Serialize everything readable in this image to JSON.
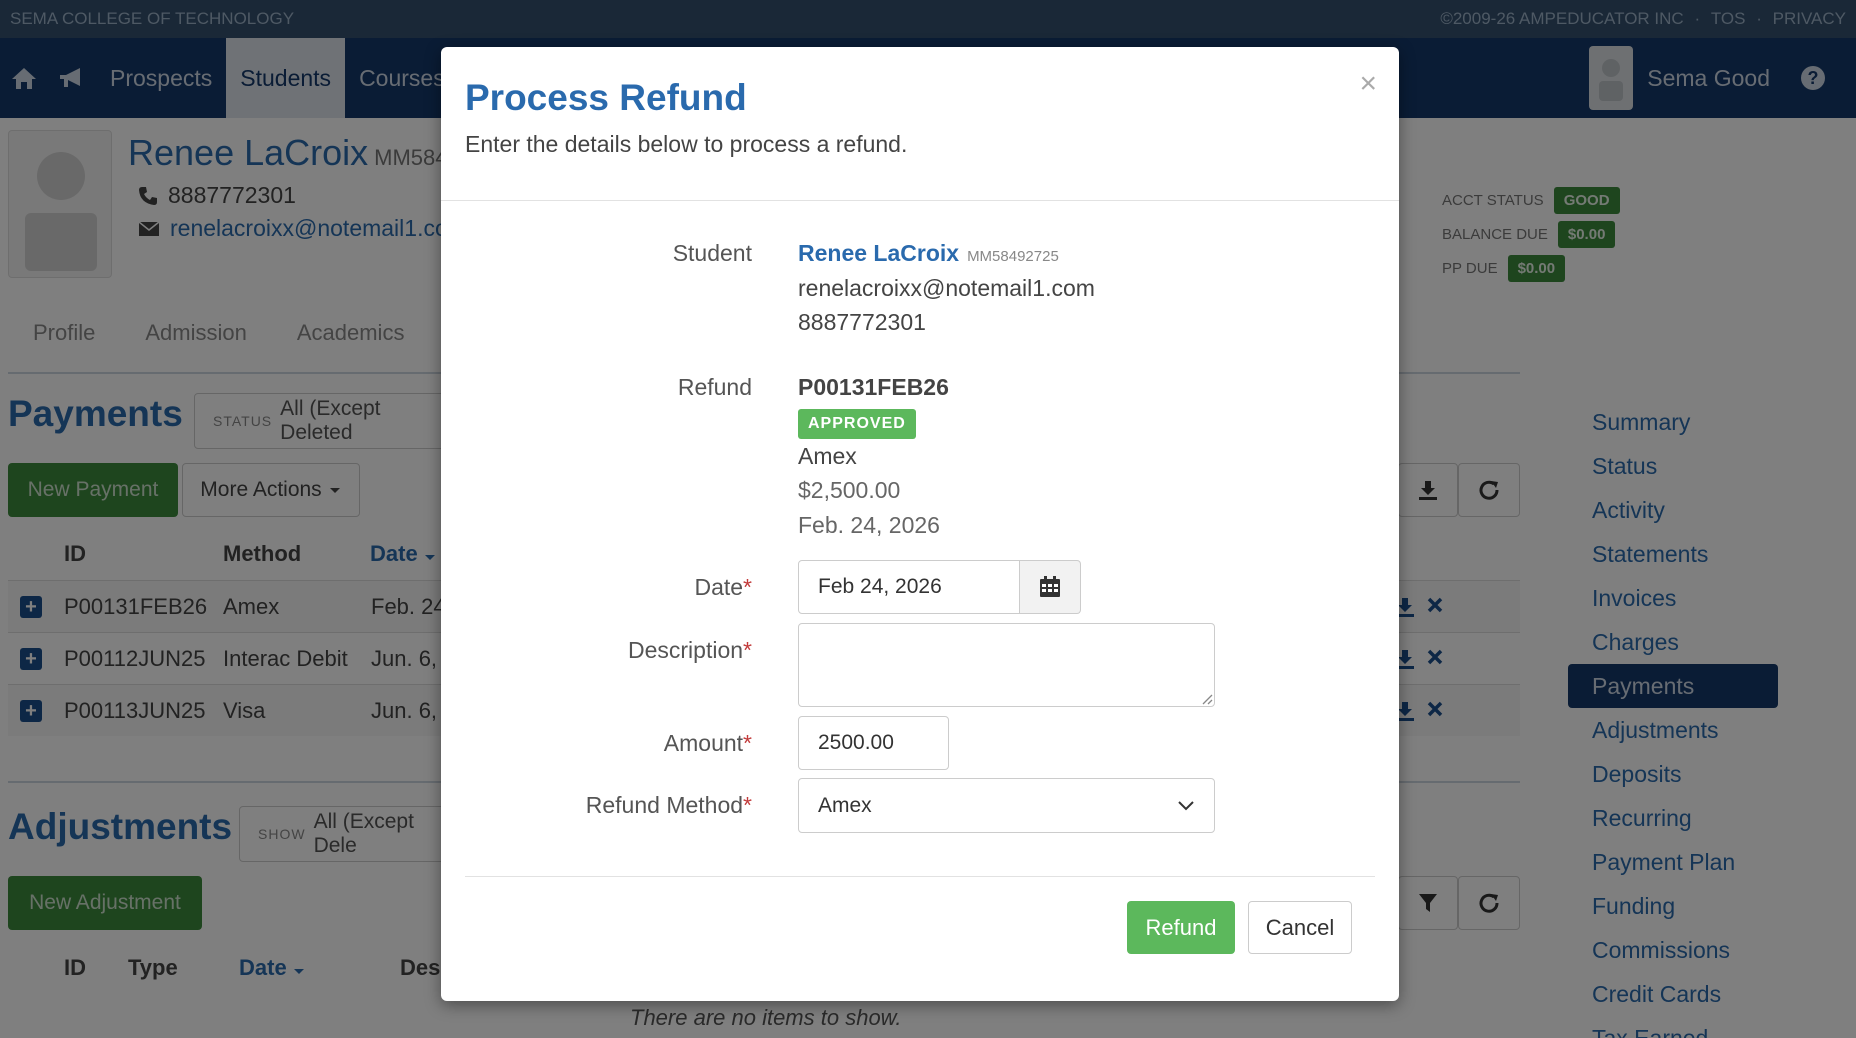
{
  "topbar": {
    "org": "SEMA COLLEGE OF TECHNOLOGY",
    "copyright": "©2009-26 AMPEDUCATOR INC",
    "tos": "TOS",
    "privacy": "PRIVACY",
    "separator": "·"
  },
  "nav": {
    "items": [
      {
        "label": "Prospects"
      },
      {
        "label": "Students"
      },
      {
        "label": "Courses"
      }
    ],
    "user_name": "Sema Good"
  },
  "student": {
    "name": "Renee LaCroix",
    "id_partial": "MM584",
    "phone": "8887772301",
    "email_partial": "renelacroixx@notemail1.co"
  },
  "tabs": [
    "Profile",
    "Admission",
    "Academics"
  ],
  "payments": {
    "title": "Payments",
    "status_label": "STATUS",
    "status_value": "All (Except Deleted",
    "new_button": "New Payment",
    "more_button": "More Actions",
    "columns": [
      "ID",
      "Method",
      "Date"
    ],
    "rows": [
      {
        "id": "P00131FEB26",
        "method": "Amex",
        "date": "Feb. 24"
      },
      {
        "id": "P00112JUN25",
        "method": "Interac Debit",
        "date": "Jun. 6,"
      },
      {
        "id": "P00113JUN25",
        "method": "Visa",
        "date": "Jun. 6,"
      }
    ]
  },
  "adjustments": {
    "title": "Adjustments",
    "show_label": "SHOW",
    "show_value": "All (Except Dele",
    "new_button": "New Adjustment",
    "columns": [
      "ID",
      "Type",
      "Date",
      "Des"
    ],
    "empty_text": "There are no items to show."
  },
  "account": {
    "acct_status_label": "ACCT STATUS",
    "acct_status_value": "GOOD",
    "balance_due_label": "BALANCE DUE",
    "balance_due_value": "$0.00",
    "pp_due_label": "PP DUE",
    "pp_due_value": "$0.00"
  },
  "sidenav": {
    "items": [
      "Summary",
      "Status",
      "Activity",
      "Statements",
      "Invoices",
      "Charges",
      "Payments",
      "Adjustments",
      "Deposits",
      "Recurring",
      "Payment Plan",
      "Funding",
      "Commissions",
      "Credit Cards",
      "Tax Earned"
    ],
    "active": "Payments"
  },
  "modal": {
    "title": "Process Refund",
    "subtitle": "Enter the details below to process a refund.",
    "close": "×",
    "student_label": "Student",
    "student_name": "Renee LaCroix",
    "student_id": "MM58492725",
    "student_email": "renelacroixx@notemail1.com",
    "student_phone": "8887772301",
    "refund_label": "Refund",
    "refund_id": "P00131FEB26",
    "refund_status": "APPROVED",
    "refund_method": "Amex",
    "refund_amount": "$2,500.00",
    "refund_date": "Feb. 24, 2026",
    "date_label": "Date",
    "date_value": "Feb 24, 2026",
    "description_label": "Description",
    "description_value": "",
    "amount_label": "Amount",
    "amount_value": "2500.00",
    "method_label": "Refund Method",
    "method_value": "Amex",
    "required_mark": "*",
    "refund_button": "Refund",
    "cancel_button": "Cancel"
  },
  "colors": {
    "brand_blue": "#15396b",
    "link_blue": "#2a6aad",
    "success_green": "#5cb85c",
    "dark_green": "#3d8a3d"
  }
}
